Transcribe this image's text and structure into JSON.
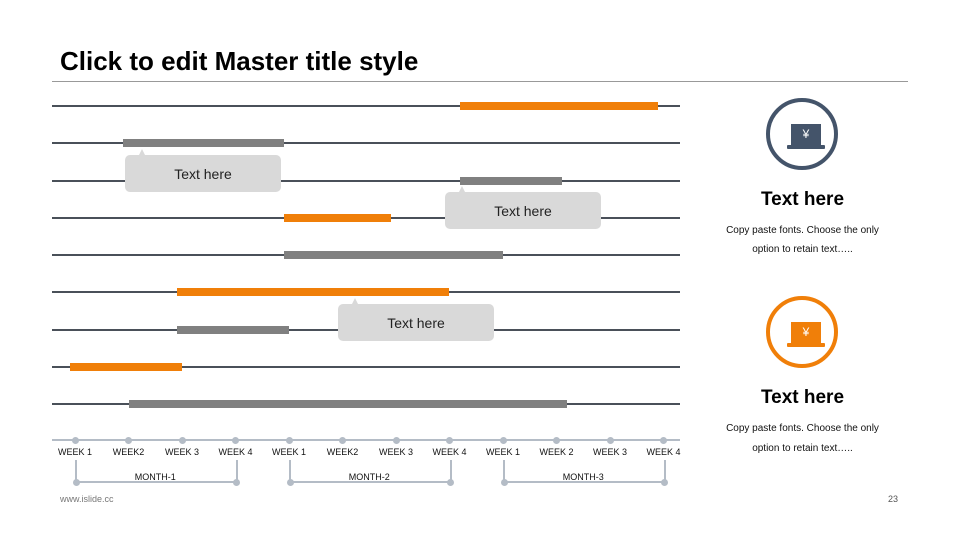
{
  "title": "Click to edit Master title style",
  "colors": {
    "orange": "#f07f09",
    "gray": "#808080",
    "navy": "#44546a",
    "line": "#4a5059",
    "timeline": "#b4bcc6"
  },
  "gantt": {
    "bars": [
      {
        "row": 1,
        "color": "orange",
        "start_week": 8.2,
        "end_week": 11.9
      },
      {
        "row": 2,
        "color": "gray",
        "start_week": 1.9,
        "end_week": 4.9
      },
      {
        "row": 3,
        "color": "gray",
        "start_week": 8.2,
        "end_week": 10.1
      },
      {
        "row": 4,
        "color": "orange",
        "start_week": 4.9,
        "end_week": 6.9
      },
      {
        "row": 5,
        "color": "gray",
        "start_week": 4.9,
        "end_week": 9.0
      },
      {
        "row": 6,
        "color": "orange",
        "start_week": 2.9,
        "end_week": 8.0
      },
      {
        "row": 7,
        "color": "gray",
        "start_week": 2.9,
        "end_week": 5.0
      },
      {
        "row": 8,
        "color": "orange",
        "start_week": 0.9,
        "end_week": 3.0
      },
      {
        "row": 9,
        "color": "gray",
        "start_week": 2.0,
        "end_week": 10.2
      }
    ]
  },
  "callouts": [
    "Text here",
    "Text here",
    "Text here"
  ],
  "timeline": {
    "weeks": [
      "WEEK 1",
      "WEEK2",
      "WEEK 3",
      "WEEK 4",
      "WEEK 1",
      "WEEK2",
      "WEEK 3",
      "WEEK 4",
      "WEEK 1",
      "WEEK 2",
      "WEEK 3",
      "WEEK 4"
    ],
    "months": [
      "MONTH-1",
      "MONTH-2",
      "MONTH-3"
    ]
  },
  "panels": [
    {
      "icon": "laptop-yen-icon",
      "heading": "Text here",
      "line1": "Copy paste fonts. Choose the only",
      "line2": "option to retain text….."
    },
    {
      "icon": "laptop-yen-icon",
      "heading": "Text here",
      "line1": "Copy paste fonts. Choose the only",
      "line2": "option to retain text….."
    }
  ],
  "icon_glyph": "¥",
  "footer": "www.islide.cc",
  "page_number": "23"
}
